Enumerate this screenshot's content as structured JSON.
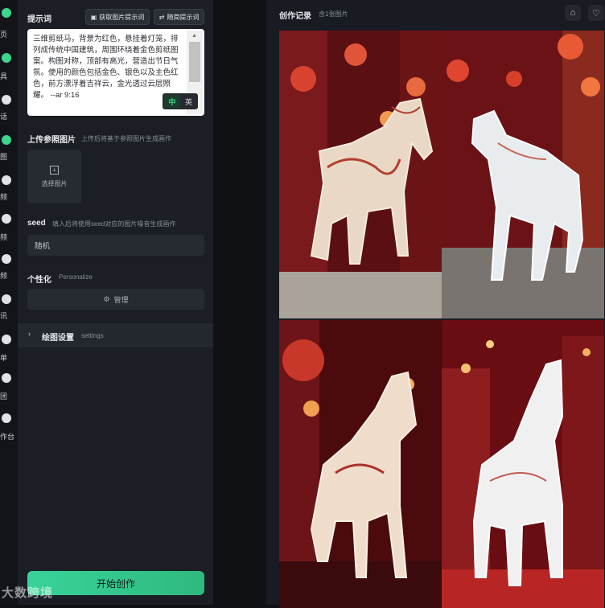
{
  "rail": {
    "items": [
      {
        "label": "页",
        "icon": "home-icon"
      },
      {
        "label": "具",
        "icon": "tools-icon"
      },
      {
        "label": "话",
        "icon": "chat-icon"
      },
      {
        "label": "图",
        "icon": "image-icon"
      },
      {
        "label": "频",
        "icon": "video-icon"
      },
      {
        "label": "频",
        "icon": "video-edit-icon"
      },
      {
        "label": "频",
        "icon": "audio-icon"
      },
      {
        "label": "讯",
        "icon": "news-icon"
      },
      {
        "label": "单",
        "icon": "list-icon"
      },
      {
        "label": "团",
        "icon": "team-icon"
      },
      {
        "label": "作台",
        "icon": "workbench-icon"
      }
    ]
  },
  "prompt": {
    "label": "提示词",
    "get_prompt_button": "获取图片提示词",
    "random_prompt_button": "随简提示词",
    "text": "三维剪纸马，背景为红色，悬挂着灯笼，排列成传统中国建筑，周围环绕着金色剪纸图案。构图对称，顶部有高光，营造出节日气氛。使用的颜色包括金色、银色以及主色红色，前方漂浮着吉祥云，金光透过云层照耀。 --ar 9:16",
    "ime_zh": "中",
    "ime_en": "英"
  },
  "reference": {
    "label": "上传参照图片",
    "hint": "上传后将基于参照图片生成画作",
    "upload_label": "选择图片"
  },
  "seed": {
    "label": "seed",
    "hint": "填入后将使用seed对应的图片噪音生成画作",
    "value": "随机"
  },
  "personalize": {
    "label": "个性化",
    "hint": "Personalize",
    "manage_button": "管理"
  },
  "settings": {
    "label": "绘图设置",
    "hint": "settings"
  },
  "cta": {
    "label": "开始创作"
  },
  "gallery": {
    "title": "创作记录",
    "count": "含1张图片",
    "images": [
      {
        "desc": "paper-cut horse, red lantern street"
      },
      {
        "desc": "white paper-cut horse, lanterns"
      },
      {
        "desc": "paper-cut horse, red background"
      },
      {
        "desc": "white paper-cut horse, red architecture"
      }
    ]
  },
  "watermark": "大数跨境",
  "colors": {
    "accent": "#38d39a",
    "panel": "#1b1e24",
    "background": "#0f1115"
  }
}
